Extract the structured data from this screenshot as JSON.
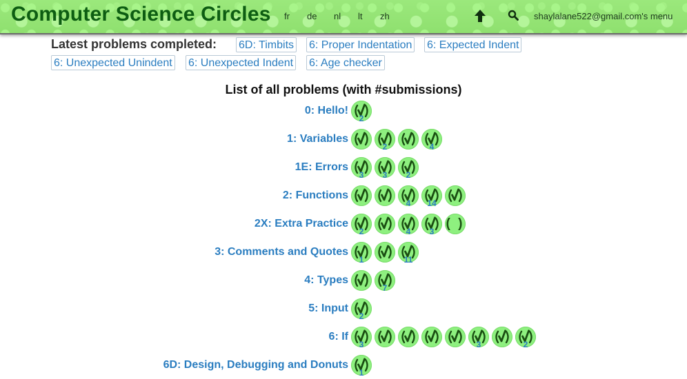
{
  "header": {
    "title": "Computer Science Circles",
    "languages": [
      "fr",
      "de",
      "nl",
      "lt",
      "zh"
    ],
    "user_menu": "shaylalane522@gmail.com's menu"
  },
  "latest": {
    "label": "Latest problems completed:",
    "items": [
      "6D: Timbits",
      "6: Proper Indentation",
      "6: Expected Indent",
      "6: Unexpected Unindent",
      "6: Unexpected Indent",
      "6: Age checker"
    ]
  },
  "list_title": "List of all problems (with #submissions)",
  "problems": [
    {
      "label": "0: Hello!",
      "badges": [
        {
          "status": "done",
          "count": "2"
        }
      ]
    },
    {
      "label": "1: Variables",
      "badges": [
        {
          "status": "done",
          "count": ""
        },
        {
          "status": "done",
          "count": "2"
        },
        {
          "status": "done",
          "count": ""
        },
        {
          "status": "done",
          "count": "4"
        }
      ]
    },
    {
      "label": "1E: Errors",
      "badges": [
        {
          "status": "done",
          "count": "3"
        },
        {
          "status": "done",
          "count": "3"
        },
        {
          "status": "done",
          "count": "2"
        }
      ]
    },
    {
      "label": "2: Functions",
      "badges": [
        {
          "status": "done",
          "count": ""
        },
        {
          "status": "done",
          "count": ""
        },
        {
          "status": "done",
          "count": "4"
        },
        {
          "status": "done",
          "count": "14"
        },
        {
          "status": "done",
          "count": ""
        }
      ]
    },
    {
      "label": "2X: Extra Practice",
      "badges": [
        {
          "status": "done",
          "count": "2"
        },
        {
          "status": "done",
          "count": ""
        },
        {
          "status": "done",
          "count": "4"
        },
        {
          "status": "done",
          "count": "3"
        },
        {
          "status": "open",
          "count": ""
        }
      ]
    },
    {
      "label": "3: Comments and Quotes",
      "badges": [
        {
          "status": "done",
          "count": "1"
        },
        {
          "status": "done",
          "count": ""
        },
        {
          "status": "done",
          "count": "11"
        }
      ]
    },
    {
      "label": "4: Types",
      "badges": [
        {
          "status": "done",
          "count": ""
        },
        {
          "status": "done",
          "count": "7"
        }
      ]
    },
    {
      "label": "5: Input",
      "badges": [
        {
          "status": "done",
          "count": "2"
        }
      ]
    },
    {
      "label": "6: If",
      "badges": [
        {
          "status": "done",
          "count": "3"
        },
        {
          "status": "done",
          "count": ""
        },
        {
          "status": "done",
          "count": ""
        },
        {
          "status": "done",
          "count": ""
        },
        {
          "status": "done",
          "count": ""
        },
        {
          "status": "done",
          "count": "3"
        },
        {
          "status": "done",
          "count": ""
        },
        {
          "status": "done",
          "count": "2"
        }
      ]
    },
    {
      "label": "6D: Design, Debugging and Donuts",
      "badges": [
        {
          "status": "done",
          "count": "1"
        }
      ]
    }
  ],
  "colors": {
    "brand": "#0d5d12",
    "link": "#2a7dc0",
    "badge_fill": "#8ef07f",
    "check": "#1a4e12",
    "header_bg": "#9be87c"
  },
  "icons": {
    "up": "arrow-up-icon",
    "search": "search-icon",
    "badge": "checkmark-badge-icon"
  }
}
